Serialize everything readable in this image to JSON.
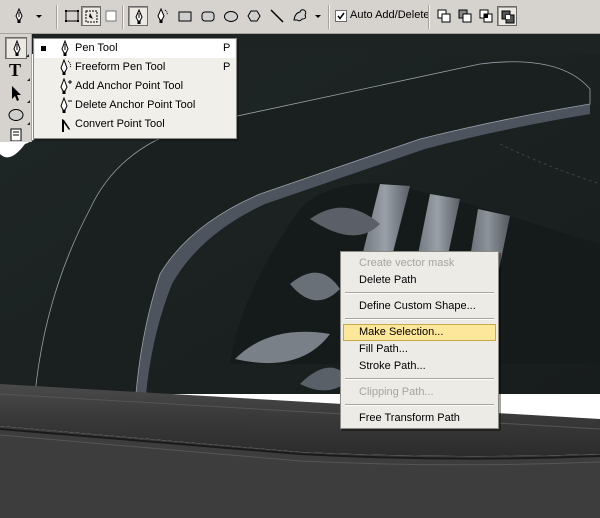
{
  "options_bar": {
    "icons": [
      "pen-tool-icon",
      "dropdown-arrow-icon",
      "shape-layers-icon",
      "paths-icon",
      "fill-pixels-icon",
      "pen-icon",
      "freeform-pen-icon",
      "rectangle-icon",
      "rounded-rectangle-icon",
      "ellipse-icon",
      "polygon-icon",
      "line-icon",
      "custom-shape-icon",
      "path-combine-icons"
    ],
    "auto_add_delete": {
      "label": "Auto Add/Delete",
      "checked": true
    }
  },
  "tools_panel": {
    "icons": [
      "pen-tool-icon",
      "type-tool-icon",
      "path-selection-icon",
      "ellipse-tool-icon",
      "notes-icon"
    ],
    "type_tool_glyph": "T"
  },
  "pen_flyout": {
    "items": [
      {
        "label": "Pen Tool",
        "shortcut": "P",
        "selected": true,
        "icon": "pen-icon"
      },
      {
        "label": "Freeform Pen Tool",
        "shortcut": "P",
        "selected": false,
        "icon": "freeform-pen-icon"
      },
      {
        "label": "Add Anchor Point Tool",
        "shortcut": "",
        "selected": false,
        "icon": "add-anchor-icon"
      },
      {
        "label": "Delete Anchor Point Tool",
        "shortcut": "",
        "selected": false,
        "icon": "delete-anchor-icon"
      },
      {
        "label": "Convert Point Tool",
        "shortcut": "",
        "selected": false,
        "icon": "convert-point-icon"
      }
    ]
  },
  "context_menu": {
    "items": [
      {
        "label": "Create vector mask",
        "enabled": false
      },
      {
        "label": "Delete Path",
        "enabled": true
      },
      {
        "label": "Define Custom Shape...",
        "enabled": true
      },
      {
        "label": "Make Selection...",
        "enabled": true,
        "highlighted": true
      },
      {
        "label": "Fill Path...",
        "enabled": true
      },
      {
        "label": "Stroke Path...",
        "enabled": true
      },
      {
        "label": "Clipping Path...",
        "enabled": false
      },
      {
        "label": "Free Transform Path",
        "enabled": true
      }
    ]
  },
  "colors": {
    "ui_gray": "#d6d3ce",
    "menu_bg": "#ecebe6",
    "highlight": "#fce79a",
    "shoe_dark": "#1d2323",
    "sole": "#3a3a3a"
  }
}
